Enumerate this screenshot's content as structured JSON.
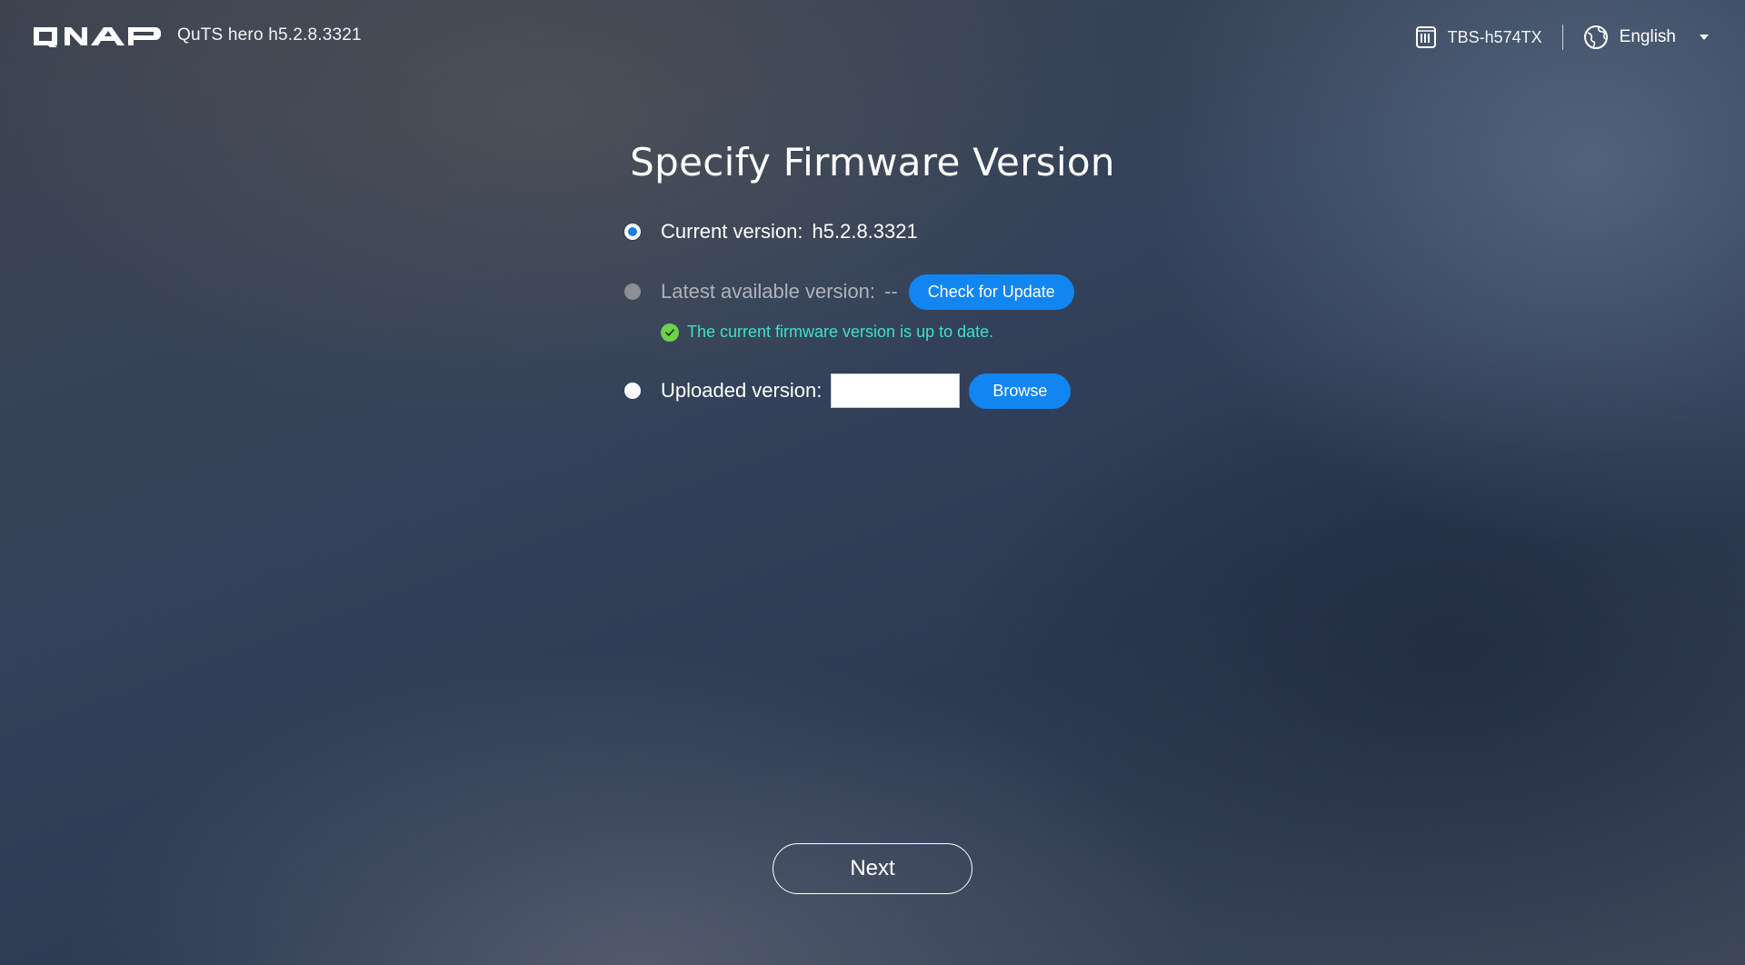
{
  "header": {
    "brand": "QNAP",
    "firmware_label": "QuTS hero h5.2.8.3321",
    "device_name": "TBS-h574TX",
    "device_icon": "nas-device-icon",
    "language": "English",
    "language_icon": "globe-icon"
  },
  "main": {
    "title": "Specify Firmware Version",
    "options": {
      "current": {
        "label": "Current version:",
        "value": "h5.2.8.3321",
        "selected": true
      },
      "latest": {
        "label": "Latest available version:",
        "value": "--",
        "button_label": "Check for Update",
        "disabled": true
      },
      "uploaded": {
        "label": "Uploaded version:",
        "input_value": "",
        "button_label": "Browse"
      }
    },
    "status": {
      "icon": "check-circle-icon",
      "text": "The current firmware version is up to date."
    }
  },
  "footer": {
    "next_label": "Next"
  },
  "colors": {
    "accent": "#1186f0",
    "status_text": "#3fe0c8",
    "status_icon": "#6fd04a"
  }
}
